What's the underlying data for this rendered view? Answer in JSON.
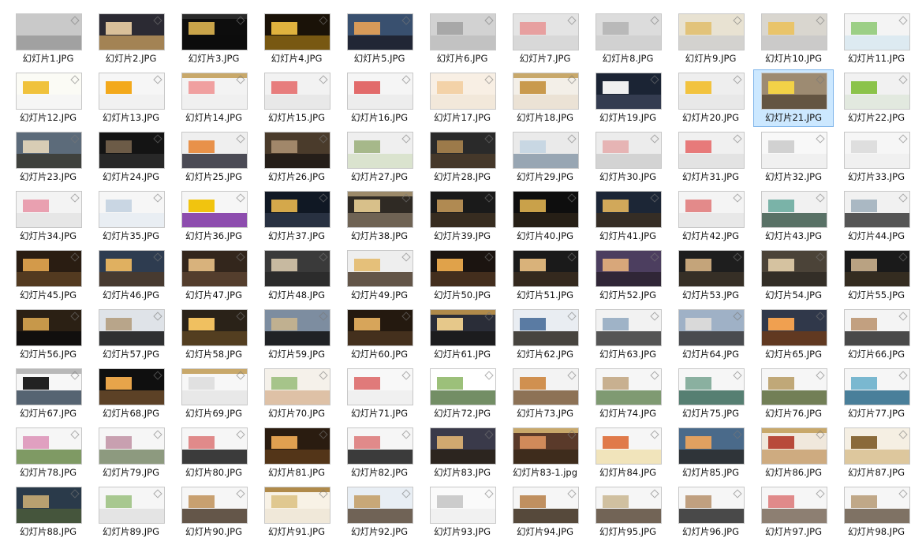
{
  "window": {
    "view": "large-icons",
    "selected_file": "幻灯片21.JPG"
  },
  "files": [
    {
      "name": "幻灯片1.JPG",
      "thumb": {
        "bg": "#c9c9c9",
        "band": "#9a9a9a",
        "bar": "",
        "block": ""
      }
    },
    {
      "name": "幻灯片2.JPG",
      "thumb": {
        "bg": "#2b2a33",
        "band": "#b8935a",
        "bar": "",
        "block": "#d9c09a"
      }
    },
    {
      "name": "幻灯片3.JPG",
      "thumb": {
        "bg": "#0d0d0d",
        "band": "#0d0d0d",
        "bar": "#2a2a2a",
        "block": "#c9a44a"
      }
    },
    {
      "name": "幻灯片4.JPG",
      "thumb": {
        "bg": "#1a1208",
        "band": "#8a6514",
        "bar": "",
        "block": "#e0b23e"
      }
    },
    {
      "name": "幻灯片5.JPG",
      "thumb": {
        "bg": "#39506f",
        "band": "#1d1f2b",
        "bar": "",
        "block": "#d79a59"
      }
    },
    {
      "name": "幻灯片6.JPG",
      "thumb": {
        "bg": "#d2d2d2",
        "band": "#bfbfbf",
        "bar": "",
        "block": "#a8a8a8"
      }
    },
    {
      "name": "幻灯片7.JPG",
      "thumb": {
        "bg": "#e4e4e4",
        "band": "#d6d6d6",
        "bar": "",
        "block": "#e7a0a0"
      }
    },
    {
      "name": "幻灯片8.JPG",
      "thumb": {
        "bg": "#dcdcdc",
        "band": "#cfcfcf",
        "bar": "",
        "block": "#b9b9b9"
      }
    },
    {
      "name": "幻灯片9.JPG",
      "thumb": {
        "bg": "#e8e2d2",
        "band": "#cfcfcf",
        "bar": "",
        "block": "#e2c37a"
      }
    },
    {
      "name": "幻灯片10.JPG",
      "thumb": {
        "bg": "#d9d6cf",
        "band": "#c8c8c8",
        "bar": "",
        "block": "#e9c46a"
      }
    },
    {
      "name": "幻灯片11.JPG",
      "thumb": {
        "bg": "#f4f4f4",
        "band": "#d8e8f0",
        "bar": "",
        "block": "#9ccf86"
      }
    },
    {
      "name": "幻灯片12.JPG",
      "thumb": {
        "bg": "#fbfbf5",
        "band": "#f5f5f5",
        "bar": "",
        "block": "#f0c23c"
      }
    },
    {
      "name": "幻灯片13.JPG",
      "thumb": {
        "bg": "#f6f6f6",
        "band": "#f0f0f0",
        "bar": "",
        "block": "#f3a91c"
      }
    },
    {
      "name": "幻灯片14.JPG",
      "thumb": {
        "bg": "#f3f3f3",
        "band": "#eeeeee",
        "bar": "#c8a86a",
        "block": "#f0a0a0"
      }
    },
    {
      "name": "幻灯片15.JPG",
      "thumb": {
        "bg": "#f2f2f2",
        "band": "#e6e6e6",
        "bar": "",
        "block": "#e77d7d"
      }
    },
    {
      "name": "幻灯片16.JPG",
      "thumb": {
        "bg": "#f5f5f5",
        "band": "#ebebeb",
        "bar": "",
        "block": "#e26b6b"
      }
    },
    {
      "name": "幻灯片17.JPG",
      "thumb": {
        "bg": "#f8efe4",
        "band": "#f1e6d8",
        "bar": "",
        "block": "#f3d2a8"
      }
    },
    {
      "name": "幻灯片18.JPG",
      "thumb": {
        "bg": "#f3efe8",
        "band": "#e9dfd1",
        "bar": "#c8a86a",
        "block": "#c99a4e"
      }
    },
    {
      "name": "幻灯片19.JPG",
      "thumb": {
        "bg": "#1b2434",
        "band": "#384156",
        "bar": "",
        "block": "#f0f0f0"
      }
    },
    {
      "name": "幻灯片20.JPG",
      "thumb": {
        "bg": "#eeeeee",
        "band": "#e6e6e6",
        "bar": "",
        "block": "#f2c33f"
      }
    },
    {
      "name": "幻灯片21.JPG",
      "thumb": {
        "bg": "#9d8b72",
        "band": "#5a4b3a",
        "bar": "",
        "block": "#f2d247"
      }
    },
    {
      "name": "幻灯片22.JPG",
      "thumb": {
        "bg": "#f1f1f1",
        "band": "#dfe7dc",
        "bar": "",
        "block": "#8bc34a"
      }
    },
    {
      "name": "幻灯片23.JPG",
      "thumb": {
        "bg": "#5c6b7a",
        "band": "#3a3a32",
        "bar": "",
        "block": "#d8cdb5"
      }
    },
    {
      "name": "幻灯片24.JPG",
      "thumb": {
        "bg": "#141414",
        "band": "#2b2b2b",
        "bar": "",
        "block": "#6c5b47"
      }
    },
    {
      "name": "幻灯片25.JPG",
      "thumb": {
        "bg": "#efefef",
        "band": "#2e2e3a",
        "bar": "",
        "block": "#e8914a"
      }
    },
    {
      "name": "幻灯片26.JPG",
      "thumb": {
        "bg": "#4a3b2b",
        "band": "#1f1a16",
        "bar": "",
        "block": "#a1876a"
      }
    },
    {
      "name": "幻灯片27.JPG",
      "thumb": {
        "bg": "#efefef",
        "band": "#d6e0c8",
        "bar": "",
        "block": "#a6b88a"
      }
    },
    {
      "name": "幻灯片28.JPG",
      "thumb": {
        "bg": "#2a2a2a",
        "band": "#4a3b2a",
        "bar": "",
        "block": "#9c7a4a"
      }
    },
    {
      "name": "幻灯片29.JPG",
      "thumb": {
        "bg": "#eaeaea",
        "band": "#8a9aa9",
        "bar": "",
        "block": "#c8d7e3"
      }
    },
    {
      "name": "幻灯片30.JPG",
      "thumb": {
        "bg": "#ececec",
        "band": "#cfcfcf",
        "bar": "",
        "block": "#e6b4b4"
      }
    },
    {
      "name": "幻灯片31.JPG",
      "thumb": {
        "bg": "#f0f0f0",
        "band": "#e0e0e0",
        "bar": "",
        "block": "#e77a7a"
      }
    },
    {
      "name": "幻灯片32.JPG",
      "thumb": {
        "bg": "#f8f8f8",
        "band": "#efefef",
        "bar": "",
        "block": "#d1d1d1"
      }
    },
    {
      "name": "幻灯片33.JPG",
      "thumb": {
        "bg": "#f6f6f6",
        "band": "#efefef",
        "bar": "",
        "block": "#dedede"
      }
    },
    {
      "name": "幻灯片34.JPG",
      "thumb": {
        "bg": "#f3f3f3",
        "band": "#e3e3e3",
        "bar": "",
        "block": "#e9a0b0"
      }
    },
    {
      "name": "幻灯片35.JPG",
      "thumb": {
        "bg": "#f6f6f6",
        "band": "#e6ecf2",
        "bar": "",
        "block": "#c9d6e3"
      }
    },
    {
      "name": "幻灯片36.JPG",
      "thumb": {
        "bg": "#f6f6f6",
        "band": "#7a2fa1",
        "bar": "",
        "block": "#f1c40f"
      }
    },
    {
      "name": "幻灯片37.JPG",
      "thumb": {
        "bg": "#101824",
        "band": "#2d3646",
        "bar": "",
        "block": "#d4a84b"
      }
    },
    {
      "name": "幻灯片38.JPG",
      "thumb": {
        "bg": "#2f2a24",
        "band": "#7a6d5d",
        "bar": "#9c8a6a",
        "block": "#d8c08a"
      }
    },
    {
      "name": "幻灯片39.JPG",
      "thumb": {
        "bg": "#1a1a1a",
        "band": "#3d3022",
        "bar": "",
        "block": "#b08a52"
      }
    },
    {
      "name": "幻灯片40.JPG",
      "thumb": {
        "bg": "#0e0e0e",
        "band": "#2a2218",
        "bar": "",
        "block": "#c9a14a"
      }
    },
    {
      "name": "幻灯片41.JPG",
      "thumb": {
        "bg": "#1c2636",
        "band": "#3a2f22",
        "bar": "",
        "block": "#d1a85a"
      }
    },
    {
      "name": "幻灯片42.JPG",
      "thumb": {
        "bg": "#f4f4f4",
        "band": "#e5e5e5",
        "bar": "",
        "block": "#e38a8a"
      }
    },
    {
      "name": "幻灯片43.JPG",
      "thumb": {
        "bg": "#f1f1f1",
        "band": "#3e5a4d",
        "bar": "",
        "block": "#7ab3a8"
      }
    },
    {
      "name": "幻灯片44.JPG",
      "thumb": {
        "bg": "#f1f1f1",
        "band": "#3a3a3a",
        "bar": "",
        "block": "#aab8c3"
      }
    },
    {
      "name": "幻灯片45.JPG",
      "thumb": {
        "bg": "#2a1d12",
        "band": "#5a3f23",
        "bar": "",
        "block": "#d39a4a"
      }
    },
    {
      "name": "幻灯片46.JPG",
      "thumb": {
        "bg": "#2e3c50",
        "band": "#4b3a2a",
        "bar": "",
        "block": "#e0b060"
      }
    },
    {
      "name": "幻灯片47.JPG",
      "thumb": {
        "bg": "#33261c",
        "band": "#5a4330",
        "bar": "",
        "block": "#d8b27c"
      }
    },
    {
      "name": "幻灯片48.JPG",
      "thumb": {
        "bg": "#3a3a3a",
        "band": "#2a2a2a",
        "bar": "",
        "block": "#c7b9a0"
      }
    },
    {
      "name": "幻灯片49.JPG",
      "thumb": {
        "bg": "#eeeeee",
        "band": "#4a3a2a",
        "bar": "",
        "block": "#e5c07a"
      }
    },
    {
      "name": "幻灯片50.JPG",
      "thumb": {
        "bg": "#1b1410",
        "band": "#4a3320",
        "bar": "",
        "block": "#e0a24a"
      }
    },
    {
      "name": "幻灯片51.JPG",
      "thumb": {
        "bg": "#1a1a1a",
        "band": "#3a2d20",
        "bar": "",
        "block": "#d9b27a"
      }
    },
    {
      "name": "幻灯片52.JPG",
      "thumb": {
        "bg": "#4c3e5f",
        "band": "#2b2230",
        "bar": "",
        "block": "#d8a77a"
      }
    },
    {
      "name": "幻灯片53.JPG",
      "thumb": {
        "bg": "#1e1e1e",
        "band": "#3b3328",
        "bar": "",
        "block": "#c4a47a"
      }
    },
    {
      "name": "幻灯片54.JPG",
      "thumb": {
        "bg": "#4b4338",
        "band": "#2f2a24",
        "bar": "",
        "block": "#d5c2a0"
      }
    },
    {
      "name": "幻灯片55.JPG",
      "thumb": {
        "bg": "#1a1a1a",
        "band": "#3a3022",
        "bar": "",
        "block": "#b9a282"
      }
    },
    {
      "name": "幻灯片56.JPG",
      "thumb": {
        "bg": "#2b2014",
        "band": "#0d0d0d",
        "bar": "",
        "block": "#c7984a"
      }
    },
    {
      "name": "幻灯片57.JPG",
      "thumb": {
        "bg": "#dfe3e8",
        "band": "#101010",
        "bar": "",
        "block": "#b8a58a"
      }
    },
    {
      "name": "幻灯片58.JPG",
      "thumb": {
        "bg": "#2a2218",
        "band": "#5a4322",
        "bar": "",
        "block": "#f0c060"
      }
    },
    {
      "name": "幻灯片59.JPG",
      "thumb": {
        "bg": "#7d8da0",
        "band": "#0f0f0f",
        "bar": "",
        "block": "#c0b090"
      }
    },
    {
      "name": "幻灯片60.JPG",
      "thumb": {
        "bg": "#24190f",
        "band": "#4a3520",
        "bar": "",
        "block": "#d7a55a"
      }
    },
    {
      "name": "幻灯片61.JPG",
      "thumb": {
        "bg": "#2a2d38",
        "band": "#1a1a1a",
        "bar": "#b08a4a",
        "block": "#e6c88a"
      }
    },
    {
      "name": "幻灯片62.JPG",
      "thumb": {
        "bg": "#e9edf2",
        "band": "#2a2620",
        "bar": "",
        "block": "#5a7ba3"
      }
    },
    {
      "name": "幻灯片63.JPG",
      "thumb": {
        "bg": "#f2f2f2",
        "band": "#3a3a3a",
        "bar": "",
        "block": "#9fb3c7"
      }
    },
    {
      "name": "幻灯片64.JPG",
      "thumb": {
        "bg": "#9fb1c6",
        "band": "#3a3a3a",
        "bar": "",
        "block": "#d9d9d9"
      }
    },
    {
      "name": "幻灯片65.JPG",
      "thumb": {
        "bg": "#30384a",
        "band": "#6a3a1a",
        "bar": "",
        "block": "#f0a050"
      }
    },
    {
      "name": "幻灯片66.JPG",
      "thumb": {
        "bg": "#f4f4f4",
        "band": "#2a2a2a",
        "bar": "",
        "block": "#c2a080"
      }
    },
    {
      "name": "幻灯片67.JPG",
      "thumb": {
        "bg": "#f7f7f7",
        "band": "#3a4a5a",
        "bar": "#b8b8b8",
        "block": "#222222"
      }
    },
    {
      "name": "幻灯片68.JPG",
      "thumb": {
        "bg": "#0f0f0f",
        "band": "#6a4a2a",
        "bar": "",
        "block": "#e7a44a"
      }
    },
    {
      "name": "幻灯片69.JPG",
      "thumb": {
        "bg": "#f7f7f7",
        "band": "#e5e5e5",
        "bar": "#c8a86a",
        "block": "#e0e0e0"
      }
    },
    {
      "name": "幻灯片70.JPG",
      "thumb": {
        "bg": "#f5f1ea",
        "band": "#d9b89a",
        "bar": "",
        "block": "#a6c48a"
      }
    },
    {
      "name": "幻灯片71.JPG",
      "thumb": {
        "bg": "#f8f8f8",
        "band": "#efefef",
        "bar": "",
        "block": "#e07a7a"
      }
    },
    {
      "name": "幻灯片72.JPG",
      "thumb": {
        "bg": "#ffffff",
        "band": "#5a7a4a",
        "bar": "",
        "block": "#9cc07a"
      }
    },
    {
      "name": "幻灯片73.JPG",
      "thumb": {
        "bg": "#f3f3f3",
        "band": "#7a5a3a",
        "bar": "",
        "block": "#d09050"
      }
    },
    {
      "name": "幻灯片74.JPG",
      "thumb": {
        "bg": "#f6f6f6",
        "band": "#6a8a5a",
        "bar": "",
        "block": "#c8b090"
      }
    },
    {
      "name": "幻灯片75.JPG",
      "thumb": {
        "bg": "#f6f6f6",
        "band": "#3a6a5a",
        "bar": "",
        "block": "#8ab0a0"
      }
    },
    {
      "name": "幻灯片76.JPG",
      "thumb": {
        "bg": "#f6f6f6",
        "band": "#5a6a3a",
        "bar": "",
        "block": "#c0a878"
      }
    },
    {
      "name": "幻灯片77.JPG",
      "thumb": {
        "bg": "#f6f6f6",
        "band": "#2a6a8a",
        "bar": "",
        "block": "#7ab8d0"
      }
    },
    {
      "name": "幻灯片78.JPG",
      "thumb": {
        "bg": "#f6f6f6",
        "band": "#6a8a4a",
        "bar": "",
        "block": "#e0a0c0"
      }
    },
    {
      "name": "幻灯片79.JPG",
      "thumb": {
        "bg": "#f6f6f6",
        "band": "#7a8a6a",
        "bar": "",
        "block": "#c8a0b0"
      }
    },
    {
      "name": "幻灯片80.JPG",
      "thumb": {
        "bg": "#f6f6f6",
        "band": "#1a1a1a",
        "bar": "",
        "block": "#e08a8a"
      }
    },
    {
      "name": "幻灯片81.JPG",
      "thumb": {
        "bg": "#2a1c10",
        "band": "#5a3a1a",
        "bar": "",
        "block": "#e0a050"
      }
    },
    {
      "name": "幻灯片82.JPG",
      "thumb": {
        "bg": "#f6f6f6",
        "band": "#1a1a1a",
        "bar": "",
        "block": "#e08a8a"
      }
    },
    {
      "name": "幻灯片83.JPG",
      "thumb": {
        "bg": "#3a3a4a",
        "band": "#2a2218",
        "bar": "",
        "block": "#d0a870"
      }
    },
    {
      "name": "幻灯片83-1.jpg",
      "thumb": {
        "bg": "#5a3a2a",
        "band": "#3a2a1a",
        "bar": "#c8a86a",
        "block": "#d08a5a"
      }
    },
    {
      "name": "幻灯片84.JPG",
      "thumb": {
        "bg": "#f6f6f6",
        "band": "#f0e0b0",
        "bar": "",
        "block": "#e07a4a"
      }
    },
    {
      "name": "幻灯片85.JPG",
      "thumb": {
        "bg": "#4a6a8a",
        "band": "#2a2a2a",
        "bar": "",
        "block": "#e0a060"
      }
    },
    {
      "name": "幻灯片86.JPG",
      "thumb": {
        "bg": "#f0e8dc",
        "band": "#c8a070",
        "bar": "#c8a86a",
        "block": "#b84a3a"
      }
    },
    {
      "name": "幻灯片87.JPG",
      "thumb": {
        "bg": "#f5efe3",
        "band": "#d8c090",
        "bar": "",
        "block": "#8a6a3a"
      }
    },
    {
      "name": "幻灯片88.JPG",
      "thumb": {
        "bg": "#2a3a4a",
        "band": "#4a5a3a",
        "bar": "",
        "block": "#b8a070"
      }
    },
    {
      "name": "幻灯片89.JPG",
      "thumb": {
        "bg": "#f6f6f6",
        "band": "#e0e0e0",
        "bar": "",
        "block": "#a8c890"
      }
    },
    {
      "name": "幻灯片90.JPG",
      "thumb": {
        "bg": "#f6f6f6",
        "band": "#4a3a2a",
        "bar": "",
        "block": "#c8a070"
      }
    },
    {
      "name": "幻灯片91.JPG",
      "thumb": {
        "bg": "#f8f2e6",
        "band": "#efe6d6",
        "bar": "#b08a4a",
        "block": "#e0c890"
      }
    },
    {
      "name": "幻灯片92.JPG",
      "thumb": {
        "bg": "#e8eef4",
        "band": "#5a4a3a",
        "bar": "",
        "block": "#c8a878"
      }
    },
    {
      "name": "幻灯片93.JPG",
      "thumb": {
        "bg": "#fafafa",
        "band": "#eeeeee",
        "bar": "",
        "block": "#cccccc"
      }
    },
    {
      "name": "幻灯片94.JPG",
      "thumb": {
        "bg": "#f6f6f6",
        "band": "#3a2a1a",
        "bar": "",
        "block": "#c09060"
      }
    },
    {
      "name": "幻灯片95.JPG",
      "thumb": {
        "bg": "#f6f6f6",
        "band": "#5a4a3a",
        "bar": "",
        "block": "#d0c0a0"
      }
    },
    {
      "name": "幻灯片96.JPG",
      "thumb": {
        "bg": "#f6f6f6",
        "band": "#2a2a2a",
        "bar": "",
        "block": "#c0a080"
      }
    },
    {
      "name": "幻灯片97.JPG",
      "thumb": {
        "bg": "#f6f6f6",
        "band": "#7a6a5a",
        "bar": "",
        "block": "#e08a8a"
      }
    },
    {
      "name": "幻灯片98.JPG",
      "thumb": {
        "bg": "#f6f6f6",
        "band": "#6a5a4a",
        "bar": "",
        "block": "#c0a888"
      }
    }
  ]
}
